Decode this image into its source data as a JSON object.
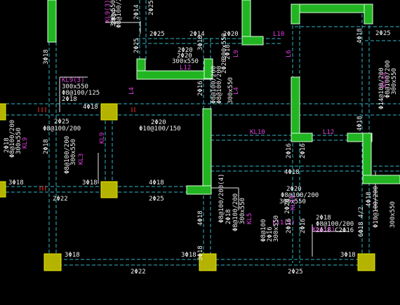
{
  "colors": {
    "background": "#000000",
    "wall_fill": "#22b522",
    "wall_edge": "#d8ffd8",
    "column_fill": "#b3b300",
    "column_edge": "#e8e800",
    "beam_line": "#2fb9c9",
    "beam_edge": "#d8f4ff",
    "text_white": "#f2f2f2",
    "text_magenta": "#e040e0",
    "text_red": "#ff2a2a",
    "leader_line": "#e8e8e8"
  },
  "labels": {
    "t1": "2Φ25",
    "t2": "2Φ14",
    "t3": "2Φ20",
    "t4": "2Φ20",
    "t5": "2Φ20",
    "t6": "2Φ25",
    "t7": "2Φ25",
    "t8": "Φ8@100/200",
    "t9": "300x550",
    "t10": "2Φ20",
    "t11": "Φ10@100/150",
    "t12": "2Φ22",
    "t13": "2Φ25",
    "t14": "2Φ22",
    "t15": "2Φ25",
    "t16": "4Φ18",
    "t17": "3Φ18",
    "t18": "3Φ18",
    "t19": "4Φ18",
    "t20": "3Φ18",
    "t21": "3Φ18",
    "t22": "3Φ18",
    "t23": "3Φ18",
    "t24": "2Φ18",
    "t25": "4Φ18",
    "t26": "2Φ18",
    "t27": "2Φ18",
    "t28": "2Φ18",
    "t29": "300x550",
    "t30": "Φ8@100/125",
    "t31": "2Φ18",
    "t32": "Φ8@100/200",
    "t33": "300x550",
    "t34": "Φ8@100/200",
    "t35": "300x550",
    "t36": "2Φ20",
    "t37": "Φ8@100/200",
    "t38": "2Φ18",
    "t39": "Φ8@100/200",
    "t40": "2Φ18 C2Φ16",
    "t41": "6Φ18 4/2",
    "mt1": "KL9(3)",
    "mt2": "L10",
    "mt3": "L12",
    "mt4": "L4",
    "mt5": "L9",
    "mt6": "L6",
    "mt7": "KL10",
    "mt8": "L12",
    "mt9": "KL9",
    "mt10": "KL3",
    "mt11": "L4",
    "mt12": "KL1(2)",
    "mt13": "L11(2)",
    "mt14": "KL14",
    "mt15": "KL10",
    "mt16": "KL5",
    "vt1": "3Φ18",
    "vt2": "2Φ14",
    "vt3": "2Φ25",
    "vt4": "2Φ25",
    "vt5": "2Φ16",
    "vt6": "4Φ18",
    "vt7": "4Φ18",
    "vt8": "3Φ18",
    "vt9": "2Φ16",
    "vt10": "2Φ16",
    "vt11": "2Φ16",
    "vt12": "2Φ16",
    "vt13": "2Φ18",
    "vt14": "Φ8@100/200",
    "vt15": "2Φ18",
    "vt16": "Φ8@100/200",
    "vt17": "300x550",
    "vt18": "Φ8@100/200(4)",
    "vt19": "300x550",
    "vt20": "4Φ18",
    "vt21": "Φ8@100/200",
    "vt22": "2Φ20",
    "vt23": "300x550",
    "vt24": "Φ8@100/200",
    "vt25": "300x550",
    "vt26": "Φ14@100/200",
    "vt27": "3Φ18",
    "vt28": "2Φ18",
    "vt29": "Φ8@100/200",
    "vt30": "300x550",
    "vt31": "Φ8@100",
    "vt32": "2Φ16",
    "vt33": "300x550",
    "vt34": "Φ8@100",
    "vt35": "2Φ16",
    "vt36": "Φ8@100/200",
    "vt37": "300x550",
    "vt38": "Φ10@100/200",
    "vt39": "300x550",
    "vt40": "2Φ14",
    "vt41": "2Φ18",
    "vt42": "Φ8@100/200",
    "vt43": "300x550",
    "vt44": "2Φ16",
    "vt45": "4Φ18",
    "vt46": "2Φ20"
  }
}
